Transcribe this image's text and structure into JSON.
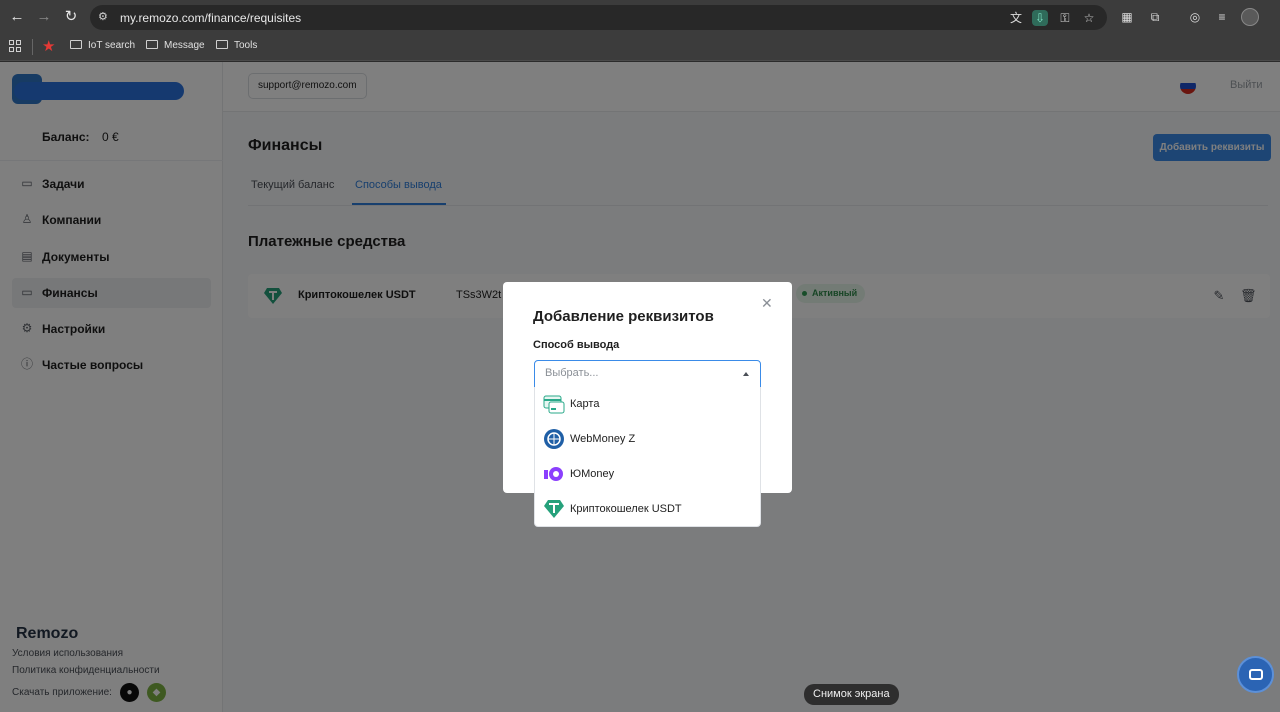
{
  "browser": {
    "url": "my.remozo.com/finance/requisites",
    "bookmarks": [
      "IoT search",
      "Message",
      "Tools"
    ]
  },
  "sidebar": {
    "balance_label": "Баланс:",
    "balance_value": "0 €",
    "items": [
      {
        "label": "Задачи",
        "icon": "folder-icon"
      },
      {
        "label": "Компании",
        "icon": "user-icon"
      },
      {
        "label": "Документы",
        "icon": "document-icon"
      },
      {
        "label": "Финансы",
        "icon": "folder-icon"
      },
      {
        "label": "Настройки",
        "icon": "gear-icon"
      },
      {
        "label": "Частые вопросы",
        "icon": "faq-icon"
      }
    ],
    "footer": {
      "logo": "Remozo",
      "terms": "Условия использования",
      "privacy": "Политика конфиденциальности",
      "download": "Скачать приложение:"
    }
  },
  "topbar": {
    "support_email": "support@remozo.com",
    "logout": "Выйти"
  },
  "main": {
    "title": "Финансы",
    "add_button": "Добавить реквизиты",
    "tabs": [
      "Текущий баланс",
      "Способы вывода"
    ],
    "section_title": "Платежные средства",
    "payment": {
      "name": "Криптокошелек USDT",
      "address": "TSs3W2t",
      "status": "Активный"
    }
  },
  "modal": {
    "title": "Добавление реквизитов",
    "field_label": "Способ вывода",
    "placeholder": "Выбрать...",
    "options": [
      "Карта",
      "WebMoney Z",
      "ЮMoney",
      "Криптокошелек USDT"
    ]
  },
  "tooltip": "Снимок экрана",
  "colors": {
    "accent": "#3a8be8",
    "active_status": "#2e8b4a",
    "overlay": "rgba(0,0,0,0.5)"
  }
}
